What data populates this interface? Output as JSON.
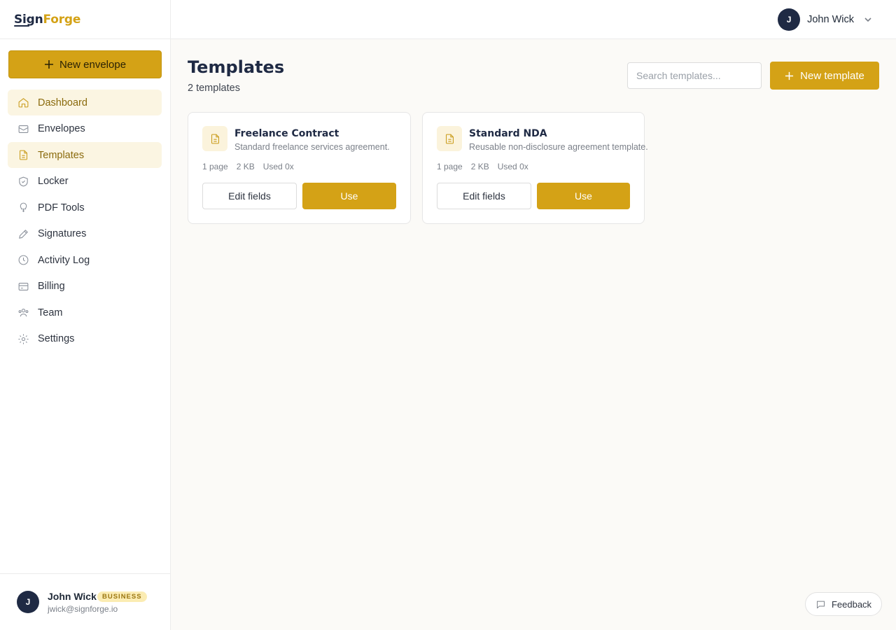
{
  "brand": {
    "part1": "Sign",
    "part2": "Forge"
  },
  "sidebar": {
    "new_envelope_label": "New envelope",
    "items": [
      {
        "label": "Dashboard",
        "icon": "home-icon",
        "active": true
      },
      {
        "label": "Envelopes",
        "icon": "envelope-icon",
        "active": false
      },
      {
        "label": "Templates",
        "icon": "document-icon",
        "active": true
      },
      {
        "label": "Locker",
        "icon": "shield-icon",
        "active": false
      },
      {
        "label": "PDF Tools",
        "icon": "bulb-icon",
        "active": false
      },
      {
        "label": "Signatures",
        "icon": "pen-icon",
        "active": false
      },
      {
        "label": "Activity Log",
        "icon": "clock-icon",
        "active": false
      },
      {
        "label": "Billing",
        "icon": "card-icon",
        "active": false
      },
      {
        "label": "Team",
        "icon": "team-icon",
        "active": false
      },
      {
        "label": "Settings",
        "icon": "gear-icon",
        "active": false
      }
    ],
    "user": {
      "initial": "J",
      "name": "John Wick",
      "plan": "BUSINESS",
      "email": "jwick@signforge.io"
    }
  },
  "topbar": {
    "user_initial": "J",
    "user_name": "John Wick"
  },
  "main": {
    "title": "Templates",
    "subtitle": "2 templates",
    "search_placeholder": "Search templates...",
    "new_template_label": "New template",
    "templates": [
      {
        "title": "Freelance Contract",
        "description": "Standard freelance services agreement.",
        "pages": "1 page",
        "size": "2 KB",
        "used": "Used 0x",
        "edit_label": "Edit fields",
        "use_label": "Use"
      },
      {
        "title": "Standard NDA",
        "description": "Reusable non-disclosure agreement template.",
        "pages": "1 page",
        "size": "2 KB",
        "used": "Used 0x",
        "edit_label": "Edit fields",
        "use_label": "Use"
      }
    ]
  },
  "feedback_label": "Feedback",
  "colors": {
    "accent": "#d4a216",
    "navy": "#1f2a44",
    "active_bg": "#fbf5e2"
  }
}
